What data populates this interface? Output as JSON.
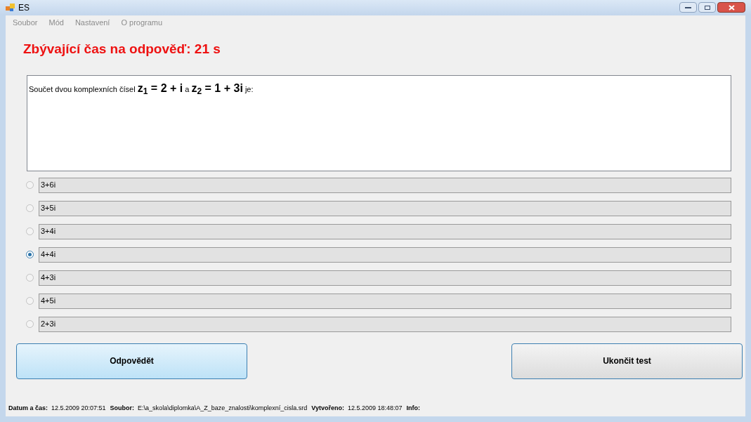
{
  "window": {
    "title": "ES"
  },
  "menu": [
    "Soubor",
    "Mód",
    "Nastavení",
    "O programu"
  ],
  "timer": "Zbývající čas na odpověď: 21 s",
  "question": "Součet dvou komplexních čísel **z$_{1}$ = 2 + i**  a **z$_{2}$ = 1 + 3i** je:",
  "options": [
    {
      "text": "3+6i",
      "selected": false
    },
    {
      "text": "3+5i",
      "selected": false
    },
    {
      "text": "3+4i",
      "selected": false
    },
    {
      "text": "4+4i",
      "selected": true
    },
    {
      "text": "4+3i",
      "selected": false
    },
    {
      "text": "4+5i",
      "selected": false
    },
    {
      "text": "2+3i",
      "selected": false
    }
  ],
  "buttons": [
    {
      "label": "Odpovědět",
      "kind": "primary"
    },
    {
      "label": "Ukončit test",
      "kind": "secondary"
    }
  ],
  "status_bar": [
    {
      "label": "Datum a čas:",
      "value": "12.5.2009 20:07:51"
    },
    {
      "label": "Soubor:",
      "value": "E:\\a_skola\\diplomka\\A_Z_baze_znalosti\\komplexní_cisla.srd"
    },
    {
      "label": "Vytvořeno:",
      "value": "12.5.2009 18:48:07"
    },
    {
      "label": "Info:"
    }
  ]
}
